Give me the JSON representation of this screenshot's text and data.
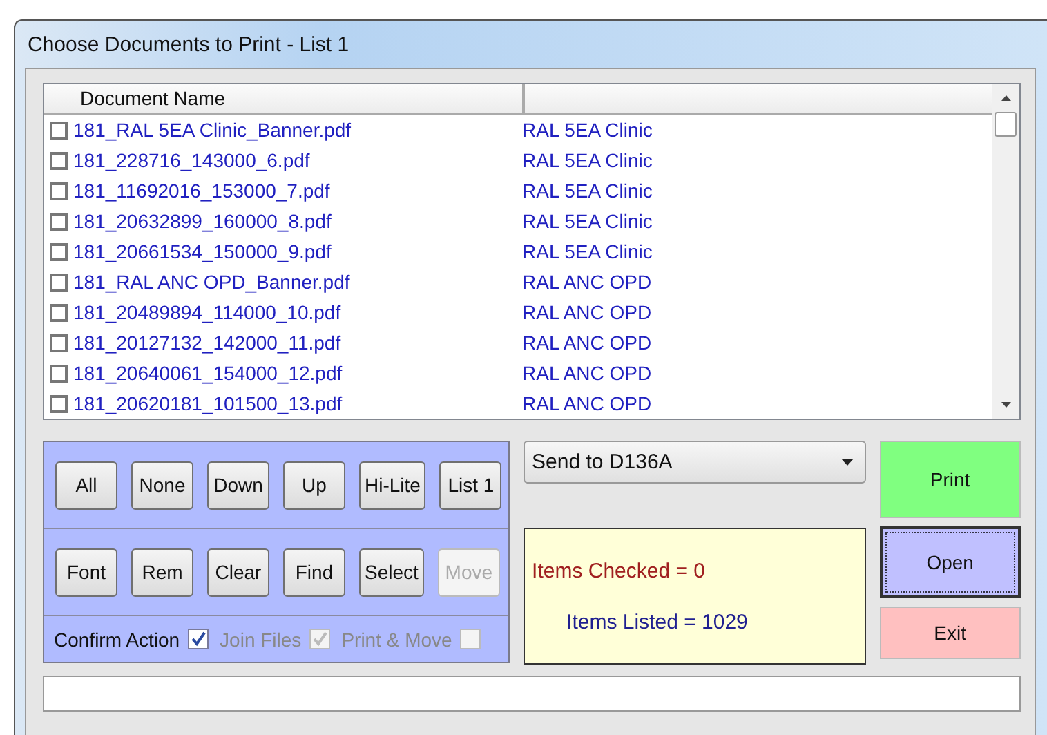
{
  "window": {
    "title": "Choose Documents to Print - List 1"
  },
  "list": {
    "columns": [
      "Document Name"
    ],
    "rows": [
      {
        "name": "181_RAL 5EA Clinic_Banner.pdf",
        "group": "RAL 5EA Clinic",
        "checked": false
      },
      {
        "name": "181_228716_143000_6.pdf",
        "group": "RAL 5EA Clinic",
        "checked": false
      },
      {
        "name": "181_11692016_153000_7.pdf",
        "group": "RAL 5EA Clinic",
        "checked": false
      },
      {
        "name": "181_20632899_160000_8.pdf",
        "group": "RAL 5EA Clinic",
        "checked": false
      },
      {
        "name": "181_20661534_150000_9.pdf",
        "group": "RAL 5EA Clinic",
        "checked": false
      },
      {
        "name": "181_RAL ANC OPD_Banner.pdf",
        "group": "RAL ANC OPD",
        "checked": false
      },
      {
        "name": "181_20489894_114000_10.pdf",
        "group": "RAL ANC OPD",
        "checked": false
      },
      {
        "name": "181_20127132_142000_11.pdf",
        "group": "RAL ANC OPD",
        "checked": false
      },
      {
        "name": "181_20640061_154000_12.pdf",
        "group": "RAL ANC OPD",
        "checked": false
      },
      {
        "name": "181_20620181_101500_13.pdf",
        "group": "RAL ANC OPD",
        "checked": false
      }
    ]
  },
  "button_rows": [
    [
      {
        "label": "All",
        "disabled": false
      },
      {
        "label": "None",
        "disabled": false
      },
      {
        "label": "Down",
        "disabled": false
      },
      {
        "label": "Up",
        "disabled": false
      },
      {
        "label": "Hi-Lite",
        "disabled": false
      },
      {
        "label": "List 1",
        "disabled": false
      }
    ],
    [
      {
        "label": "Font",
        "disabled": false
      },
      {
        "label": "Rem",
        "disabled": false
      },
      {
        "label": "Clear",
        "disabled": false
      },
      {
        "label": "Find",
        "disabled": false
      },
      {
        "label": "Select",
        "disabled": false
      },
      {
        "label": "Move",
        "disabled": true
      }
    ]
  ],
  "options": [
    {
      "label": "Confirm Action",
      "checked": true,
      "disabled": false
    },
    {
      "label": "Join Files",
      "checked": true,
      "disabled": true
    },
    {
      "label": "Print & Move",
      "checked": false,
      "disabled": true
    }
  ],
  "printer": {
    "value": "Send to D136A"
  },
  "info": [
    {
      "kind": "checked",
      "text": "Items Checked = 0"
    },
    {
      "kind": "listed",
      "text": "Items Listed = 1029"
    }
  ],
  "actions": [
    {
      "kind": "print",
      "label": "Print",
      "focused": false
    },
    {
      "kind": "open",
      "label": "Open",
      "focused": true
    },
    {
      "kind": "exit",
      "label": "Exit",
      "focused": false
    }
  ]
}
